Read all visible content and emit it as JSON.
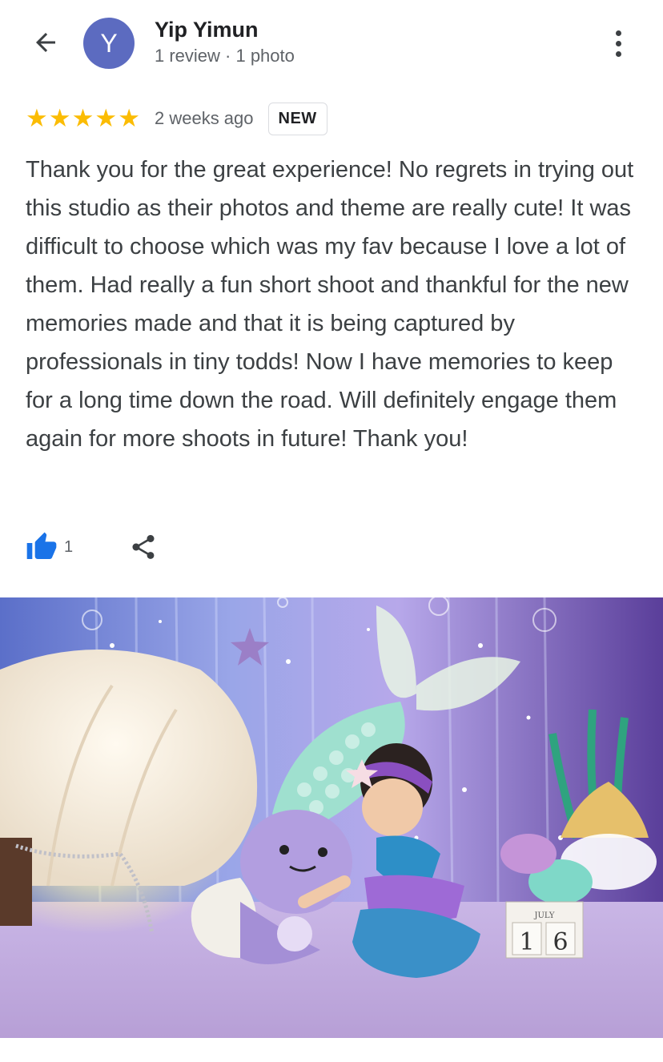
{
  "header": {
    "back_icon": "arrow-left-icon",
    "avatar_letter": "Y",
    "avatar_color": "#5c6bc0",
    "reviewer_name": "Yip Yimun",
    "reviewer_meta": "1 review · 1 photo",
    "more_icon": "more-vert-icon"
  },
  "review": {
    "rating": 5,
    "star_color": "#fbbc04",
    "time_ago": "2 weeks ago",
    "badge": "NEW",
    "text": "Thank you for the great experience! No regrets in trying out this studio as their photos and theme are really cute! It was difficult to choose which was my fav because I love a lot of them. Had really a fun short shoot and thankful for the new memories made and that it is being captured by professionals in tiny todds! Now I have memories to keep for a long time down the road. Will definitely engage them again for more shoots in future! Thank you!"
  },
  "actions": {
    "like_icon": "thumbs-up-icon",
    "like_color": "#1a73e8",
    "like_count": "1",
    "share_icon": "share-icon"
  },
  "photo": {
    "calendar_month": "JULY",
    "calendar_day_1": "1",
    "calendar_day_2": "6"
  }
}
